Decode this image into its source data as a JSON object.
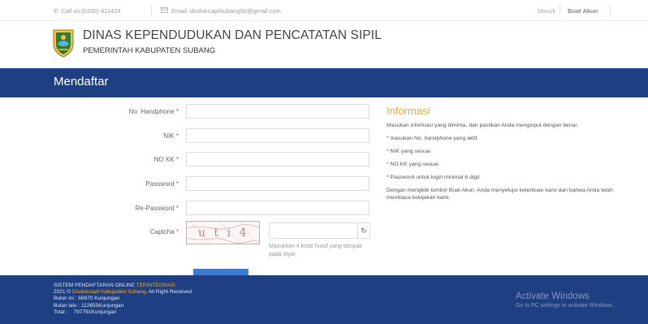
{
  "topbar": {
    "phone": "Call us:(0260) 411424",
    "email": "Email: disdukcapilsubang50@gmail.com",
    "login": "Masuk",
    "signup": "Buat Akun"
  },
  "brand": {
    "title": "DINAS KEPENDUDUKAN DAN PENCATATAN SIPIL",
    "subtitle": "PEMERINTAH KABUPATEN SUBANG"
  },
  "page_title": "Mendaftar",
  "form": {
    "required_mark": "*",
    "fields": [
      {
        "label": "No. Handphone",
        "value": "",
        "placeholder": ""
      },
      {
        "label": "NIK",
        "value": "",
        "placeholder": ""
      },
      {
        "label": "NO KK",
        "value": "",
        "placeholder": ""
      },
      {
        "label": "Password",
        "value": "",
        "placeholder": ""
      },
      {
        "label": "Re-Password",
        "value": "",
        "placeholder": ""
      }
    ],
    "captcha_label": "Captcha",
    "captcha_text": "u t i 4",
    "captcha_hint": "Masukkan 4 kode huruf yang tampak pada layar."
  },
  "info": {
    "title": "Informasi",
    "intro": "Masukan informasi yang diminta, dan pastikan Anda menginput dengan benar.",
    "items": [
      "* masukan No. handphone yang aktif",
      "* NIK yang sesuai",
      "* NO KK yang sesuai",
      "* Password untuk login minimal 6 digit"
    ],
    "outro": "Dengan mengklik tombol Buat Akun, Anda menyetujui ketentuan kami dan bahwa Anda telah membaca kebijakan kami."
  },
  "footer": {
    "system": "SISTEM PENDAFTARAN ONLINE",
    "system_tag": "TERINTEGRASI",
    "year": "2021 ©",
    "org": "Disdukcapil Kabupaten Subang",
    "rights": ". All Right Received.",
    "stats": [
      {
        "label": "Bulan ini :",
        "value": "68870  Kunjungan"
      },
      {
        "label": "Bulan lalu :",
        "value": "112655Kunjungan"
      },
      {
        "label": "Total :",
        "value": "797791Kunjungan"
      }
    ]
  },
  "watermark": {
    "title": "Activate Windows",
    "subtitle": "Go to PC settings to activate Windows."
  },
  "colors": {
    "primary": "#1e3f82",
    "accent": "#f0a830",
    "required": "#e74c3c",
    "button": "#3a7bd5"
  }
}
